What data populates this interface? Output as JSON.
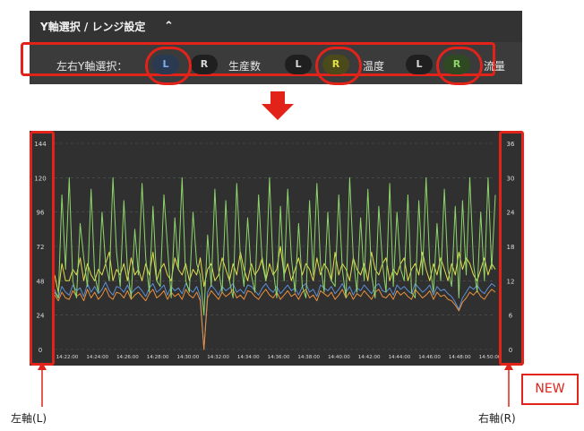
{
  "header": {
    "title": "Y軸選択 / レンジ設定",
    "caret": "⌃"
  },
  "axis_select": {
    "label": "左右Y軸選択：",
    "series": [
      {
        "name": "生産数",
        "left": "L",
        "right": "R",
        "selected": "L",
        "color": "#5b8fd6"
      },
      {
        "name": "温度",
        "left": "L",
        "right": "R",
        "selected": "R",
        "color": "#e3e04a"
      },
      {
        "name": "流量",
        "left": "L",
        "right": "R",
        "selected": "R",
        "color": "#8fd66a"
      }
    ]
  },
  "annotations": {
    "left_axis": "左軸(L)",
    "right_axis": "右軸(R)",
    "new_badge": "NEW"
  },
  "chart_data": {
    "type": "line",
    "left_ylim": [
      0,
      144
    ],
    "left_ticks": [
      "0",
      "24",
      "48",
      "72",
      "96",
      "120",
      "144"
    ],
    "right_ylim": [
      0,
      36
    ],
    "right_ticks": [
      "0",
      "6",
      "12",
      "18",
      "24",
      "30",
      "36"
    ],
    "x_ticks": [
      "14:22:00",
      "14:24:00",
      "14:26:00",
      "14:28:00",
      "14:30:00",
      "14:32:00",
      "14:34:00",
      "14:36:00",
      "14:38:00",
      "14:40:00",
      "14:42:00",
      "14:44:00",
      "14:46:00",
      "14:48:00",
      "14:50:00"
    ],
    "grid": true,
    "series": [
      {
        "axis": "left",
        "color": "#5b8fd6",
        "values": [
          42,
          36,
          44,
          40,
          38,
          45,
          41,
          43,
          37,
          46,
          40,
          44,
          39,
          42,
          47,
          41,
          38,
          44,
          43,
          40,
          45,
          39,
          42,
          44,
          41,
          37,
          43,
          46,
          40,
          42,
          45,
          38,
          44,
          41,
          43,
          39,
          46,
          42,
          40,
          44,
          37,
          0,
          40,
          45,
          42,
          38,
          44,
          41,
          43,
          46,
          40,
          42,
          39,
          45,
          44,
          41,
          38,
          43,
          46,
          42,
          40,
          44,
          39,
          42,
          45,
          41,
          43,
          38,
          44,
          46,
          40,
          42,
          37,
          45,
          43,
          41,
          44,
          39,
          42,
          46,
          40,
          44,
          38,
          43,
          41,
          45,
          42,
          39,
          44,
          46,
          41,
          40,
          43,
          38,
          45,
          42,
          44,
          41,
          39,
          46,
          43,
          40,
          42,
          45,
          38,
          44,
          41,
          42,
          39,
          37,
          33,
          28,
          36,
          40,
          44,
          42,
          45,
          41,
          39,
          43,
          46,
          44
        ]
      },
      {
        "axis": "left",
        "color": "#e8903c",
        "values": [
          38,
          34,
          40,
          36,
          35,
          41,
          37,
          39,
          34,
          42,
          36,
          40,
          35,
          38,
          43,
          37,
          35,
          40,
          39,
          36,
          41,
          35,
          38,
          40,
          37,
          34,
          39,
          42,
          36,
          38,
          41,
          35,
          40,
          37,
          39,
          35,
          42,
          38,
          36,
          40,
          34,
          0,
          36,
          41,
          38,
          35,
          40,
          37,
          39,
          42,
          36,
          38,
          35,
          41,
          40,
          37,
          35,
          39,
          42,
          38,
          36,
          40,
          35,
          38,
          41,
          37,
          39,
          35,
          40,
          42,
          36,
          38,
          34,
          41,
          39,
          37,
          40,
          35,
          38,
          42,
          36,
          40,
          35,
          39,
          37,
          41,
          38,
          35,
          40,
          42,
          37,
          36,
          39,
          35,
          41,
          38,
          40,
          37,
          35,
          42,
          39,
          36,
          38,
          41,
          35,
          40,
          37,
          38,
          35,
          34,
          31,
          27,
          33,
          36,
          40,
          38,
          41,
          37,
          35,
          39,
          42,
          40
        ]
      },
      {
        "axis": "right",
        "color": "#e3e04a",
        "values": [
          13,
          10,
          15,
          12,
          12,
          14,
          13,
          16,
          12,
          15,
          13,
          12,
          14,
          13,
          15,
          17,
          12,
          14,
          13,
          15,
          12,
          16,
          13,
          14,
          12,
          15,
          13,
          17,
          12,
          14,
          15,
          13,
          12,
          16,
          14,
          13,
          15,
          12,
          14,
          13,
          16,
          11,
          14,
          15,
          12,
          13,
          16,
          14,
          12,
          15,
          13,
          17,
          14,
          12,
          15,
          13,
          14,
          16,
          12,
          15,
          13,
          14,
          18,
          13,
          15,
          12,
          14,
          16,
          13,
          15,
          14,
          12,
          16,
          13,
          15,
          14,
          12,
          17,
          13,
          15,
          14,
          12,
          16,
          14,
          13,
          15,
          12,
          17,
          14,
          13,
          15,
          16,
          12,
          14,
          13,
          15,
          16,
          12,
          14,
          15,
          13,
          17,
          14,
          12,
          15,
          13,
          16,
          14,
          12,
          15,
          13,
          17,
          14,
          16,
          15,
          13,
          12,
          14,
          16,
          13,
          15,
          14
        ]
      },
      {
        "axis": "right",
        "color": "#8fd66a",
        "values": [
          10,
          9,
          27,
          14,
          30,
          12,
          9,
          22,
          16,
          11,
          28,
          13,
          10,
          24,
          15,
          12,
          30,
          17,
          11,
          26,
          14,
          9,
          21,
          13,
          29,
          16,
          10,
          25,
          12,
          11,
          27,
          18,
          9,
          23,
          14,
          30,
          12,
          10,
          24,
          15,
          13,
          6,
          20,
          11,
          28,
          14,
          10,
          26,
          12,
          9,
          29,
          16,
          11,
          23,
          13,
          10,
          27,
          15,
          12,
          30,
          14,
          9,
          25,
          12,
          28,
          16,
          10,
          22,
          11,
          9,
          26,
          13,
          29,
          15,
          10,
          24,
          12,
          11,
          27,
          14,
          9,
          30,
          16,
          10,
          23,
          12,
          28,
          13,
          9,
          25,
          15,
          10,
          29,
          11,
          24,
          14,
          12,
          27,
          10,
          9,
          26,
          13,
          30,
          15,
          10,
          22,
          12,
          28,
          14,
          11,
          25,
          9,
          26,
          13,
          30,
          15,
          10,
          24,
          12,
          30,
          14,
          27
        ]
      }
    ]
  }
}
